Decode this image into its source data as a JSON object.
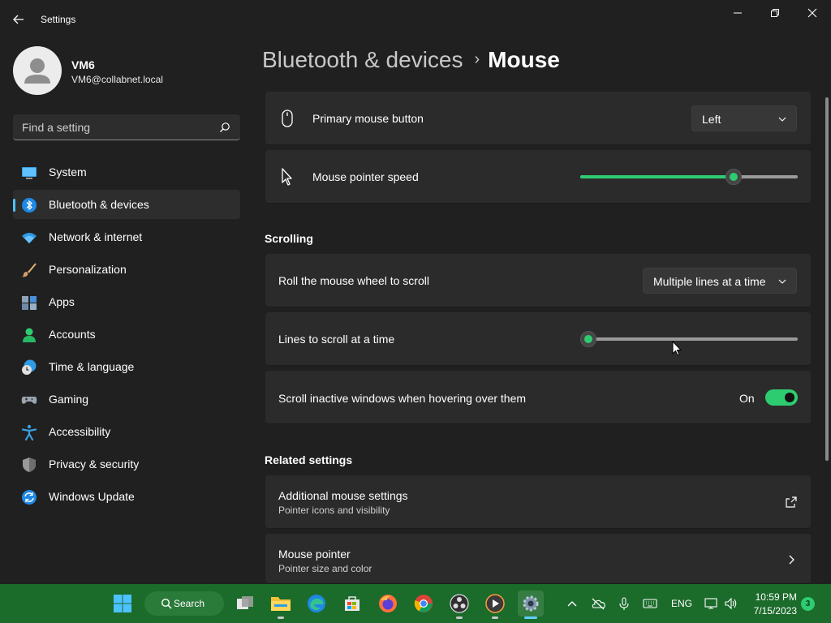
{
  "window": {
    "title": "Settings"
  },
  "profile": {
    "name": "VM6",
    "email": "VM6@collabnet.local"
  },
  "search": {
    "placeholder": "Find a setting"
  },
  "nav": {
    "items": [
      {
        "label": "System",
        "icon": "system-icon"
      },
      {
        "label": "Bluetooth & devices",
        "icon": "bluetooth-icon",
        "selected": true
      },
      {
        "label": "Network & internet",
        "icon": "wifi-icon"
      },
      {
        "label": "Personalization",
        "icon": "brush-icon"
      },
      {
        "label": "Apps",
        "icon": "apps-icon"
      },
      {
        "label": "Accounts",
        "icon": "person-icon"
      },
      {
        "label": "Time & language",
        "icon": "globe-clock-icon"
      },
      {
        "label": "Gaming",
        "icon": "gamepad-icon"
      },
      {
        "label": "Accessibility",
        "icon": "accessibility-icon"
      },
      {
        "label": "Privacy & security",
        "icon": "shield-icon"
      },
      {
        "label": "Windows Update",
        "icon": "update-icon"
      }
    ]
  },
  "breadcrumb": {
    "parent": "Bluetooth & devices",
    "separator": "›",
    "current": "Mouse"
  },
  "settings": {
    "primary_button": {
      "label": "Primary mouse button",
      "value": "Left"
    },
    "pointer_speed": {
      "label": "Mouse pointer speed",
      "level": 0.72
    },
    "scrolling_title": "Scrolling",
    "roll_wheel": {
      "label": "Roll the mouse wheel to scroll",
      "value": "Multiple lines at a time"
    },
    "lines_to_scroll": {
      "label": "Lines to scroll at a time",
      "level": 0.0
    },
    "scroll_inactive": {
      "label": "Scroll inactive windows when hovering over them",
      "state": "On"
    },
    "related_title": "Related settings",
    "additional_mouse": {
      "label": "Additional mouse settings",
      "sub": "Pointer icons and visibility"
    },
    "mouse_pointer": {
      "label": "Mouse pointer",
      "sub": "Pointer size and color"
    }
  },
  "taskbar": {
    "search_label": "Search",
    "language": "ENG",
    "time": "10:59 PM",
    "date": "7/15/2023",
    "notification_count": "3"
  },
  "colors": {
    "accent": "#4cc2ff",
    "toggle_on": "#2ecc71",
    "taskbar": "#1b6b2b"
  }
}
